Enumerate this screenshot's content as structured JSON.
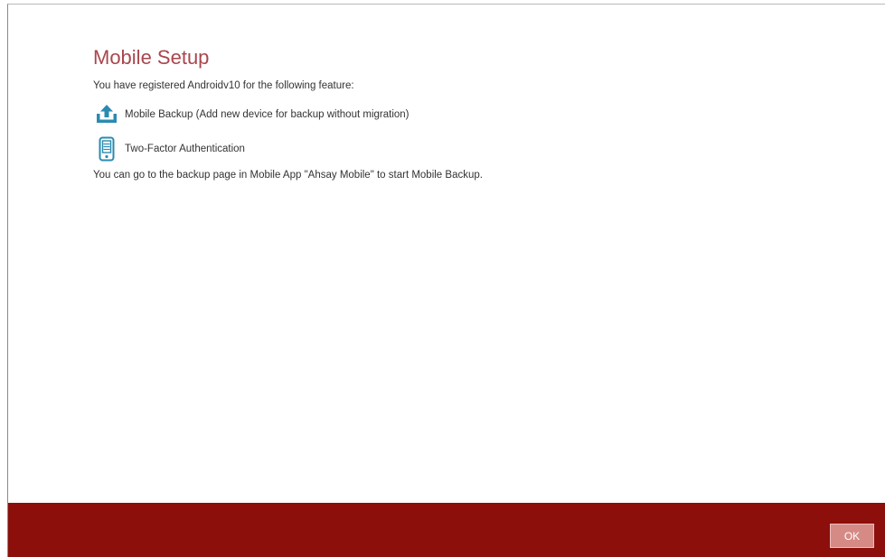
{
  "dialog": {
    "title": "Mobile Setup",
    "intro_text": "You have registered Androidv10 for the following feature:",
    "features": [
      {
        "icon": "upload-icon",
        "label": "Mobile Backup (Add new device for backup without migration)"
      },
      {
        "icon": "mobile-phone-icon",
        "label": "Two-Factor Authentication"
      }
    ],
    "footer_text": "You can go to the backup page in Mobile App \"Ahsay Mobile\" to start Mobile Backup."
  },
  "buttons": {
    "ok_label": "OK"
  },
  "colors": {
    "title": "#a8474e",
    "footer_bar": "#8c0f0b",
    "ok_button": "#d58a86",
    "icon": "#2a8bb0"
  }
}
